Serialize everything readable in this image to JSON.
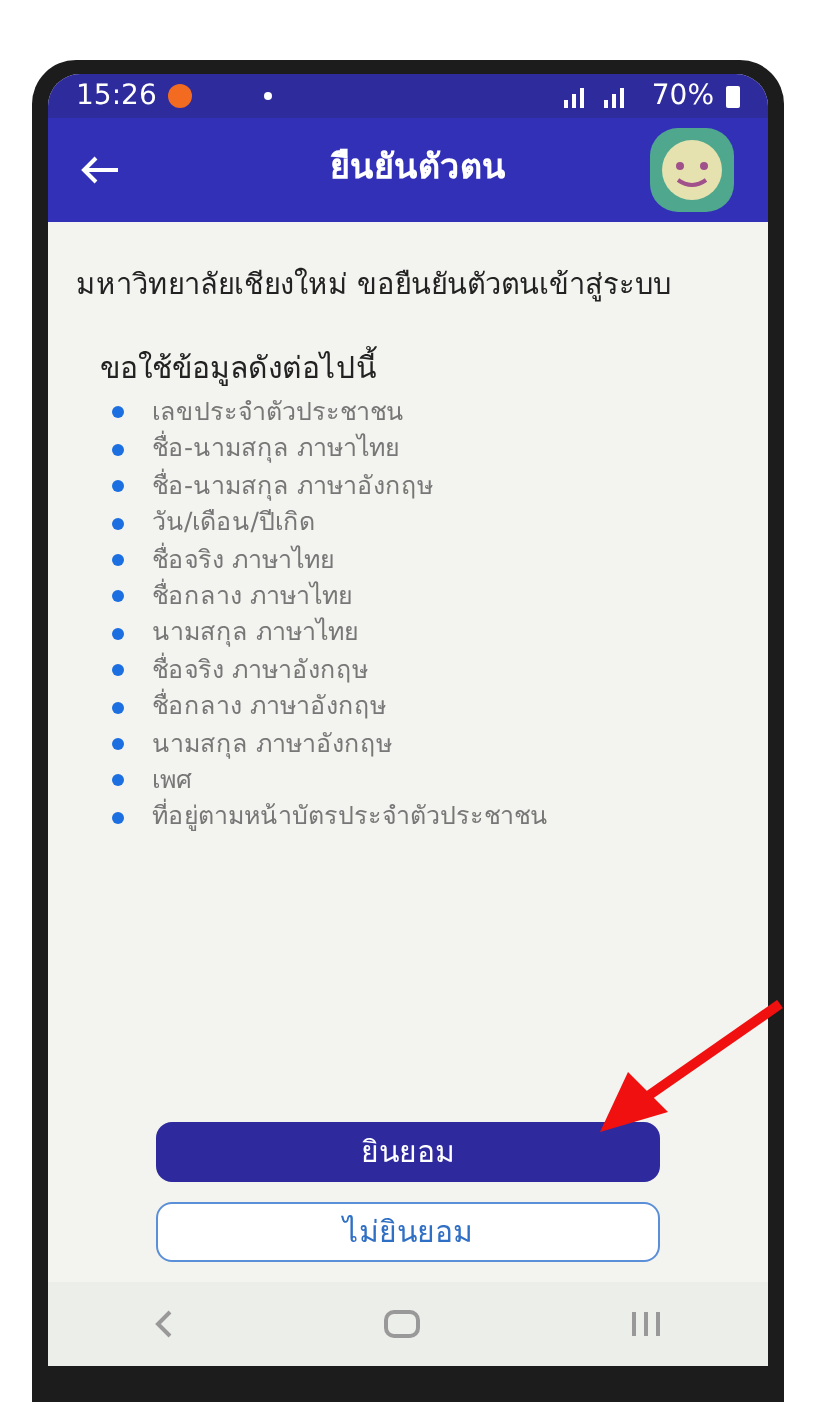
{
  "status_bar": {
    "time": "15:26",
    "battery": "70%"
  },
  "header": {
    "title": "ยืนยันตัวตน"
  },
  "intro": "มหาวิทยาลัยเชียงใหม่ ขอยืนยันตัวตนเข้าสู่ระบบ",
  "list_title": "ขอใช้ข้อมูลดังต่อไปนี้",
  "items": [
    "เลขประจำตัวประชาชน",
    "ชื่อ-นามสกุล ภาษาไทย",
    "ชื่อ-นามสกุล ภาษาอังกฤษ",
    "วัน/เดือน/ปีเกิด",
    "ชื่อจริง ภาษาไทย",
    "ชื่อกลาง ภาษาไทย",
    "นามสกุล ภาษาไทย",
    "ชื่อจริง ภาษาอังกฤษ",
    "ชื่อกลาง ภาษาอังกฤษ",
    "นามสกุล ภาษาอังกฤษ",
    "เพศ",
    "ที่อยู่ตามหน้าบัตรประจำตัวประชาชน"
  ],
  "buttons": [
    {
      "label": "ยินยอม",
      "kind": "primary"
    },
    {
      "label": "ไม่ยินยอม",
      "kind": "outline"
    }
  ]
}
